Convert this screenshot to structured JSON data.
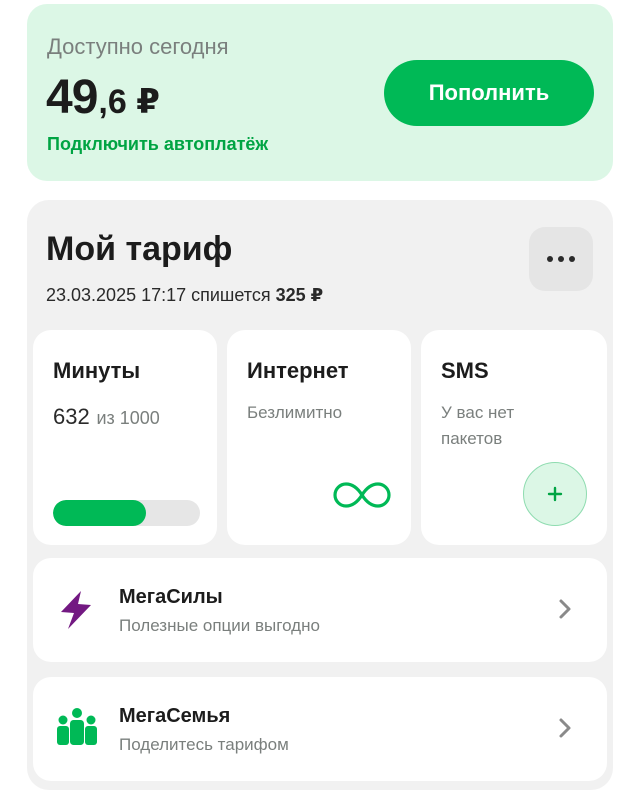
{
  "balance": {
    "label": "Доступно сегодня",
    "amount_int": "49",
    "amount_frac": ",6 ₽",
    "autopay_link": "Подключить автоплатёж",
    "topup_label": "Пополнить"
  },
  "tariff": {
    "title": "Мой тариф",
    "charge_date": "23.03.2025 17:17 спишется",
    "charge_amount": "325 ₽",
    "more_icon": "more-horizontal-icon",
    "minutes": {
      "title": "Минуты",
      "used": "632",
      "of_label": "из 1000",
      "progress_fraction": 0.632
    },
    "internet": {
      "title": "Интернет",
      "status": "Безлимитно",
      "icon": "infinity-icon"
    },
    "sms": {
      "title": "SMS",
      "status_line1": "У вас нет",
      "status_line2": "пакетов",
      "add_icon": "plus-icon"
    }
  },
  "options": [
    {
      "title": "МегаСилы",
      "subtitle": "Полезные опции выгодно",
      "icon": "lightning-icon",
      "icon_color": "#731982"
    },
    {
      "title": "МегаСемья",
      "subtitle": "Поделитесь тарифом",
      "icon": "family-icon",
      "icon_color": "#00b956"
    }
  ],
  "colors": {
    "accent": "#00b956",
    "accent_light": "#dcf7e6",
    "link": "#00a443",
    "purple": "#731982"
  }
}
